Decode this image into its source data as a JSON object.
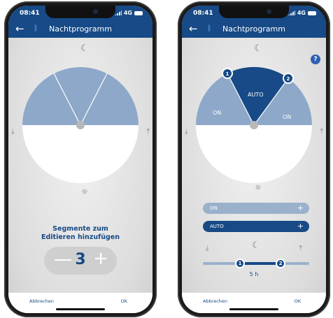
{
  "left_phone": {
    "status": {
      "time": "08:41",
      "network": "4G"
    },
    "title": "Nachtprogramm",
    "segments_prompt": "Segmente zum Editieren hinzufügen",
    "stepper": {
      "minus": "—",
      "value": "3",
      "plus": "+"
    },
    "footer": {
      "cancel": "Abbrechen",
      "ok": "OK"
    }
  },
  "right_phone": {
    "status": {
      "time": "08:41",
      "network": "4G"
    },
    "title": "Nachtprogramm",
    "help": "?",
    "dial_labels": {
      "left": "ON",
      "middle": "AUTO",
      "right": "ON"
    },
    "markers": [
      "1",
      "2"
    ],
    "segments": [
      {
        "label": "ON",
        "action": "+"
      },
      {
        "label": "AUTO",
        "action": "+"
      }
    ],
    "slider": {
      "knob1": "1",
      "knob2": "2",
      "duration": "5 h"
    },
    "footer": {
      "cancel": "Abbrechen",
      "ok": "OK"
    }
  },
  "colors": {
    "primary": "#174a86",
    "light_segment": "#9ab1cc",
    "dial_fill": "#8ea8c9"
  }
}
